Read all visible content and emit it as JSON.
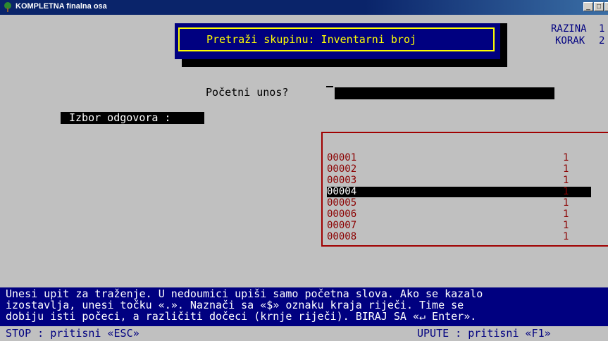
{
  "window": {
    "title": "KOMPLETNA finalna osa",
    "min_glyph": "_",
    "max_glyph": "□",
    "close_glyph": "x"
  },
  "header": {
    "dialog_title": "Pretraži skupinu: Inventarni broj",
    "level_label": "RAZINA",
    "level_value": "1",
    "step_label": "KORAK",
    "step_value": "2"
  },
  "prompt": {
    "label": "Početni unos?",
    "value": ""
  },
  "choice": {
    "label": "Izbor odgovora :"
  },
  "results": {
    "rows": [
      {
        "code": "00001",
        "count": "1",
        "selected": false
      },
      {
        "code": "00002",
        "count": "1",
        "selected": false
      },
      {
        "code": "00003",
        "count": "1",
        "selected": false
      },
      {
        "code": "00004",
        "count": "1",
        "selected": true
      },
      {
        "code": "00005",
        "count": "1",
        "selected": false
      },
      {
        "code": "00006",
        "count": "1",
        "selected": false
      },
      {
        "code": "00007",
        "count": "1",
        "selected": false
      },
      {
        "code": "00008",
        "count": "1",
        "selected": false
      }
    ]
  },
  "help": {
    "lines": [
      "Unesi upit za traženje. U nedoumici upiši samo početna slova. Ako se kazalo",
      "izostavlja, unesi točku «.». Naznači sa «$» oznaku kraja riječi. Time se",
      "dobiju isti počeci, a različiti dočeci (krnje riječi). BIRAJ SA «↵ Enter»."
    ]
  },
  "status": {
    "left": "STOP : pritisni «ESC»",
    "right": "UPUTE : pritisni «F1»"
  },
  "colors": {
    "console_bg": "#c0c0c0",
    "dialog_bg": "#000080",
    "dialog_border": "#ffff00",
    "list_text": "#8b0000",
    "help_bg": "#000080"
  }
}
